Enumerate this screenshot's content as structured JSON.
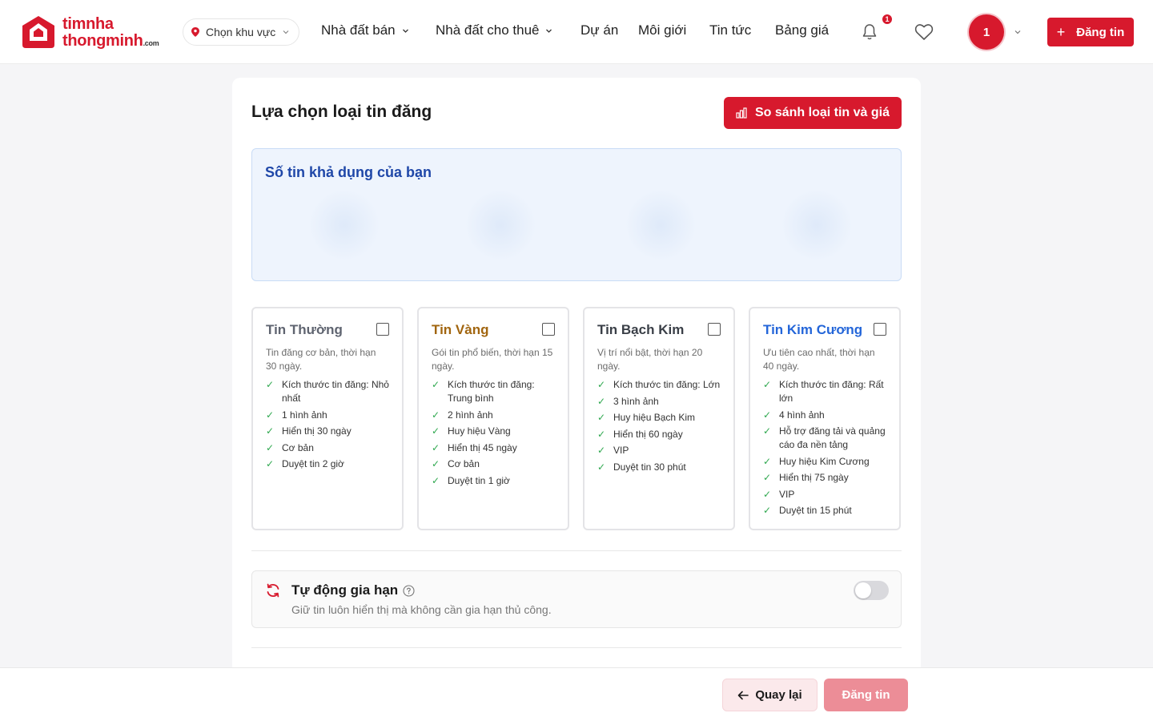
{
  "header": {
    "logo": {
      "line1": "timnha",
      "line2": "thongminh",
      "suffix": ".com"
    },
    "region": {
      "label": "Chọn khu vực",
      "icon": "map-pin-icon"
    },
    "nav": [
      {
        "label": "Nhà đất bán",
        "has_dropdown": true
      },
      {
        "label": "Nhà đất cho thuê",
        "has_dropdown": true
      },
      {
        "label": "Dự án",
        "has_dropdown": false
      },
      {
        "label": "Môi giới",
        "has_dropdown": false
      },
      {
        "label": "Tin tức",
        "has_dropdown": false
      },
      {
        "label": "Bảng giá",
        "has_dropdown": false
      }
    ],
    "notification_count": "1",
    "avatar_label": "1",
    "post_button": {
      "icon": "plus-icon",
      "label": "Đăng tin"
    }
  },
  "main": {
    "title": "Lựa chọn loại tin đăng",
    "compare_button": {
      "icon": "chart-icon",
      "label": "So sánh loại tin và giá"
    },
    "available": {
      "title": "Số tin khả dụng của bạn"
    },
    "plans": [
      {
        "name": "Tin Thường",
        "color": "#5f6470",
        "checked": false,
        "description": "Tin đăng cơ bản, thời hạn 30 ngày.",
        "features": [
          "Kích thước tin đăng: Nhỏ nhất",
          "1 hình ảnh",
          "Hiển thị 30 ngày",
          "Cơ bản",
          "Duyệt tin 2 giờ"
        ]
      },
      {
        "name": "Tin Vàng",
        "color": "#a1650f",
        "checked": false,
        "description": "Gói tin phổ biến, thời hạn 15 ngày.",
        "features": [
          "Kích thước tin đăng: Trung bình",
          "2 hình ảnh",
          "Huy hiệu Vàng",
          "Hiển thị 45 ngày",
          "Cơ bản",
          "Duyệt tin 1 giờ"
        ]
      },
      {
        "name": "Tin Bạch Kim",
        "color": "#3a3f47",
        "checked": false,
        "description": "Vị trí nổi bật, thời hạn 20 ngày.",
        "features": [
          "Kích thước tin đăng: Lớn",
          "3 hình ảnh",
          "Huy hiệu Bạch Kim",
          "Hiển thị 60 ngày",
          "VIP",
          "Duyệt tin 30 phút"
        ]
      },
      {
        "name": "Tin Kim Cương",
        "color": "#2466d9",
        "checked": false,
        "description": "Ưu tiên cao nhất, thời hạn 40 ngày.",
        "features": [
          "Kích thước tin đăng: Rất lớn",
          "4 hình ảnh",
          "Hỗ trợ đăng tải và quảng cáo đa nền tảng",
          "Huy hiệu Kim Cương",
          "Hiển thị 75 ngày",
          "VIP",
          "Duyệt tin 15 phút"
        ]
      }
    ],
    "auto_renew": {
      "icon": "refresh-icon",
      "title": "Tự động gia hạn",
      "subtitle": "Giữ tin luôn hiển thị mà không cần gia hạn thủ công.",
      "enabled": false
    }
  },
  "footer": {
    "back_button": {
      "icon": "arrow-left-icon",
      "label": "Quay lại"
    },
    "submit_button": {
      "label": "Đăng tin"
    }
  },
  "colors": {
    "brand": "#d7192d",
    "brand_light": "#ec8d97",
    "info_bg": "#eef4fd",
    "info_title": "#1f47a8",
    "check": "#2fa84f"
  }
}
